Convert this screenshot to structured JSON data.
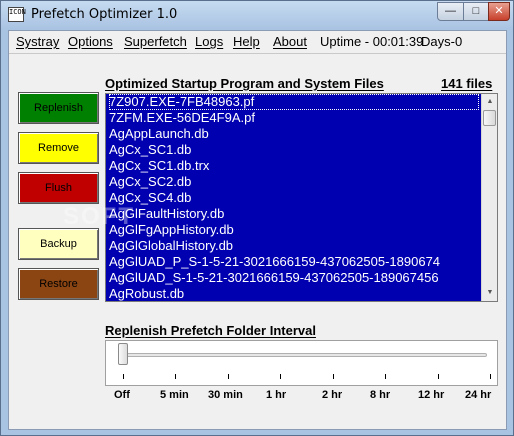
{
  "window": {
    "title": "Prefetch Optimizer 1.0",
    "icon_text": "ICON"
  },
  "menu": {
    "items": [
      "Systray",
      "Options",
      "Superfetch",
      "Logs",
      "Help",
      "About"
    ],
    "uptime": "Uptime - 00:01:39",
    "days": "Days-0"
  },
  "buttons": {
    "replenish": "Replenish",
    "remove": "Remove",
    "flush": "Flush",
    "backup": "Backup",
    "restore": "Restore"
  },
  "colors": {
    "replenish": "#008000",
    "remove": "#ffff00",
    "flush": "#c00000",
    "backup": "#ffffc0",
    "restore": "#8b4513",
    "list_selection": "#0000b0"
  },
  "list": {
    "header": "Optimized Startup Program and System Files",
    "count": "141 files",
    "rows": [
      "7Z907.EXE-7FB48963.pf",
      "7ZFM.EXE-56DE4F9A.pf",
      "AgAppLaunch.db",
      "AgCx_SC1.db",
      "AgCx_SC1.db.trx",
      "AgCx_SC2.db",
      "AgCx_SC4.db",
      "AgGlFaultHistory.db",
      "AgGlFgAppHistory.db",
      "AgGlGlobalHistory.db",
      "AgGlUAD_P_S-1-5-21-3021666159-437062505-1890674",
      "AgGlUAD_S-1-5-21-3021666159-437062505-189067456",
      "AgRobust.db"
    ]
  },
  "slider": {
    "title": "Replenish Prefetch Folder Interval",
    "value": 0,
    "ticks": [
      "Off",
      "5 min",
      "30 min",
      "1 hr",
      "2 hr",
      "8 hr",
      "12 hr",
      "24 hr"
    ]
  },
  "watermark": "SOFT"
}
